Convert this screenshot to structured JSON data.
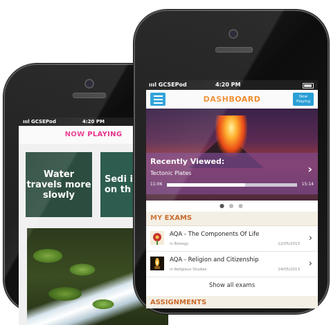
{
  "back_screen": {
    "carrier": "GCSEPod",
    "time": "4:20 PM",
    "header_title": "NOW PLAYING",
    "cards": [
      {
        "text": "Water travels more slowly"
      },
      {
        "text": "Sedi is dep on th flo"
      }
    ]
  },
  "front_screen": {
    "carrier": "GCSEPod",
    "time": "4:20 PM",
    "header_title": "DASHBOARD",
    "now_playing_button": "Now Playing",
    "recently_viewed": {
      "title": "Recently Viewed:",
      "item": "Tectonic Plates",
      "elapsed": "11:06",
      "total": "15:14",
      "progress": 0.6
    },
    "my_exams_heading": "MY EXAMS",
    "exams": [
      {
        "title": "AQA - The Components Of Life",
        "subject": "in Biology",
        "date": "12/05/2013"
      },
      {
        "title": "AQA - Religion and Citizenship",
        "subject": "in Religious Studies",
        "date": "14/05/2013"
      }
    ],
    "show_all": "Show all exams",
    "assignments_heading": "ASSIGNMENTS"
  }
}
